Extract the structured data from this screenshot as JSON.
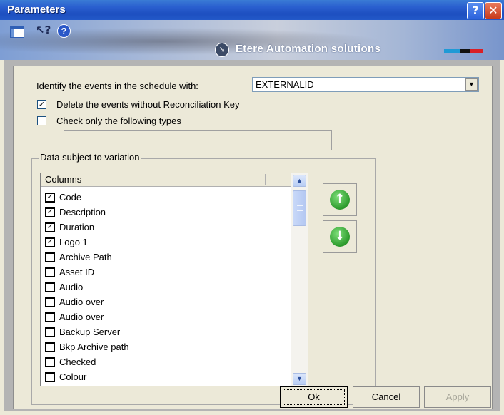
{
  "window": {
    "title": "Parameters",
    "help_button": "?",
    "close_button": "✕"
  },
  "banner": {
    "brand_text": "Etere Automation solutions",
    "brand_bar_colors": [
      "#1e9ad6",
      "#111111",
      "#d91f26"
    ],
    "icons": [
      "grid-view-icon",
      "whats-this-icon",
      "info-icon",
      "arrow-circle-icon"
    ]
  },
  "form": {
    "identify_label": "Identify the events in the schedule with:",
    "identify_value": "EXTERNALID",
    "delete_label": "Delete the events without Reconciliation Key",
    "delete_checked": true,
    "check_types_label": "Check only the following types",
    "check_types_checked": false,
    "types_value": ""
  },
  "group": {
    "title": "Data subject to variation",
    "column_header": "Columns",
    "items": [
      {
        "label": "Code",
        "checked": true
      },
      {
        "label": "Description",
        "checked": true
      },
      {
        "label": "Duration",
        "checked": true
      },
      {
        "label": "Logo 1",
        "checked": true
      },
      {
        "label": "Archive Path",
        "checked": false
      },
      {
        "label": "Asset ID",
        "checked": false
      },
      {
        "label": "Audio",
        "checked": false
      },
      {
        "label": "Audio over",
        "checked": false
      },
      {
        "label": "Audio over",
        "checked": false
      },
      {
        "label": "Backup Server",
        "checked": false
      },
      {
        "label": "Bkp Archive path",
        "checked": false
      },
      {
        "label": "Checked",
        "checked": false
      },
      {
        "label": "Colour",
        "checked": false
      }
    ]
  },
  "move_buttons": {
    "up": "↑",
    "down": "↓"
  },
  "buttons": {
    "ok": "Ok",
    "cancel": "Cancel",
    "apply": "Apply"
  }
}
